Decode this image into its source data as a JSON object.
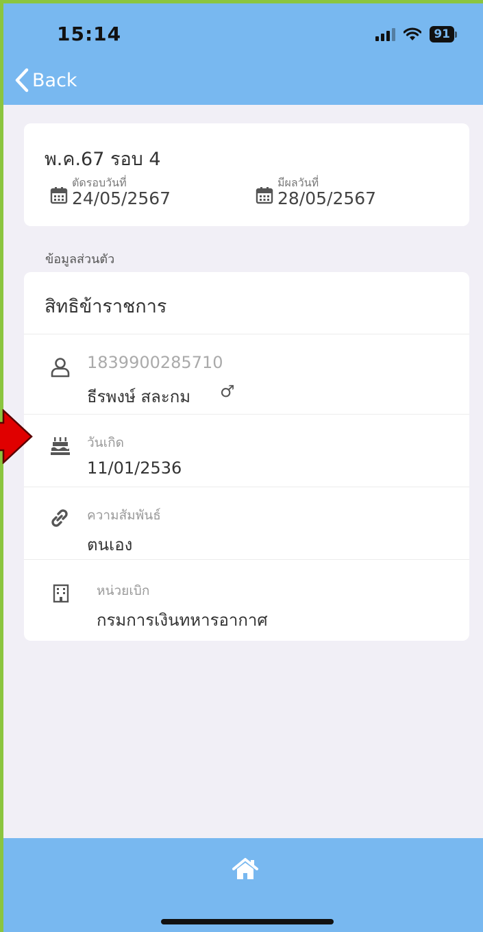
{
  "status_bar": {
    "time": "15:14",
    "battery": "91"
  },
  "nav": {
    "back_label": "Back"
  },
  "round": {
    "title": "พ.ค.67 รอบ 4",
    "cutoff_caption": "ตัดรอบวันที่",
    "cutoff_date": "24/05/2567",
    "effective_caption": "มีผลวันที่",
    "effective_date": "28/05/2567"
  },
  "section_label": "ข้อมูลส่วนตัว",
  "info": {
    "heading": "สิทธิข้าราชการ",
    "id_number": "1839900285710",
    "name": "ธีรพงษ์ สละกม",
    "gender_symbol": "♂",
    "birth_caption": "วันเกิด",
    "birth_date": "11/01/2536",
    "relation_caption": "ความสัมพันธ์",
    "relation_value": "ตนเอง",
    "unit_caption": "หน่วยเบิก",
    "unit_value": "กรมการเงินทหารอากาศ"
  },
  "icons": {
    "back": "chevron-left-icon",
    "calendar": "calendar-icon",
    "person": "person-icon",
    "cake": "birthday-cake-icon",
    "link": "link-icon",
    "building": "building-icon",
    "home": "home-icon"
  },
  "colors": {
    "header_bg": "#78b8f0",
    "page_bg": "#f1eff6",
    "icon": "#555555",
    "annotation_arrow": "#e00000"
  }
}
